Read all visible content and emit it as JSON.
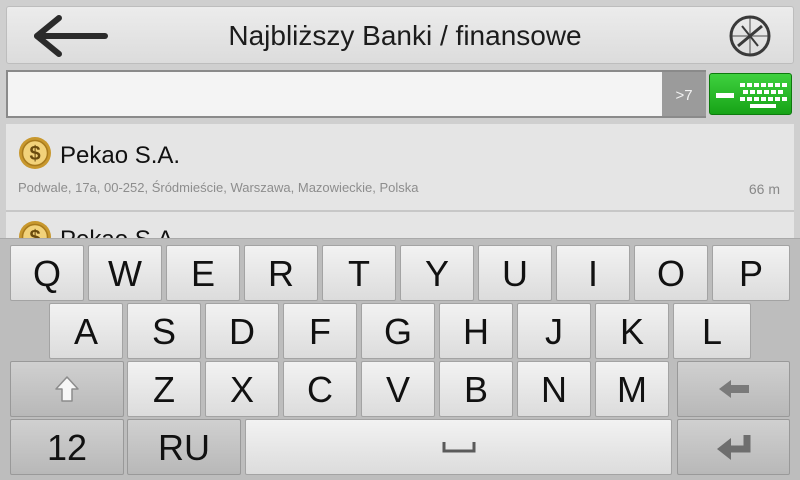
{
  "header": {
    "title": "Najbliższy Banki / finansowe",
    "back_icon": "arrow-left-icon",
    "gps_icon": "no-gps-icon"
  },
  "search": {
    "value": "",
    "placeholder": "",
    "result_count": ">7",
    "keyboard_icon": "keyboard-icon"
  },
  "results": [
    {
      "name": "Pekao S.A.",
      "address": "Podwale, 17a, 00-252, Śródmieście, Warszawa, Mazowieckie, Polska",
      "distance": "66 m",
      "icon": "bank-dollar-icon"
    },
    {
      "name": "Pekao S.A.",
      "icon": "bank-dollar-icon"
    }
  ],
  "keyboard": {
    "row1": [
      "Q",
      "W",
      "E",
      "R",
      "T",
      "Y",
      "U",
      "I",
      "O",
      "P"
    ],
    "row2": [
      "A",
      "S",
      "D",
      "F",
      "G",
      "H",
      "J",
      "K",
      "L"
    ],
    "row3": [
      "Z",
      "X",
      "C",
      "V",
      "B",
      "N",
      "M"
    ],
    "numbers_label": "12",
    "language_label": "RU",
    "shift_icon": "shift-arrow-icon",
    "backspace_icon": "backspace-arrow-icon",
    "space_icon": "space-bar-icon",
    "enter_icon": "enter-return-icon"
  }
}
